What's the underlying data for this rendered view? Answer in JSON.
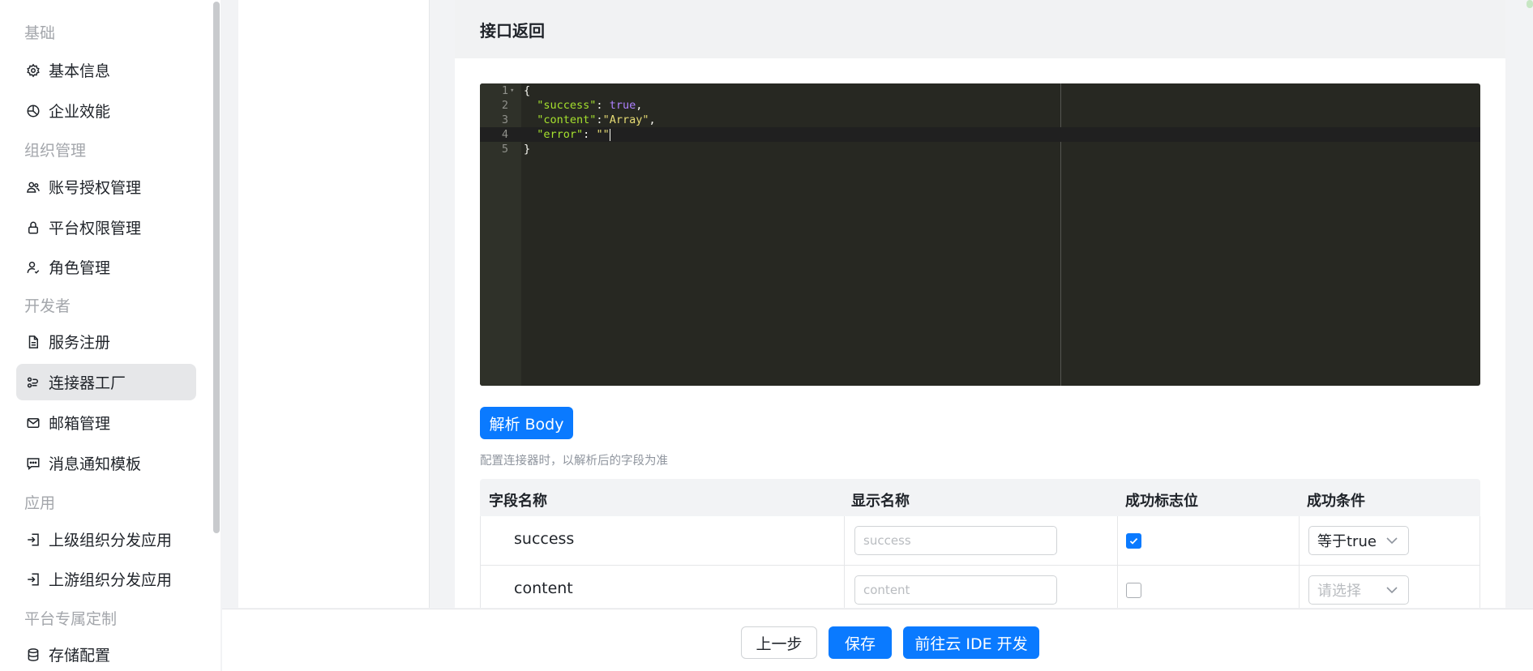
{
  "sidebar": {
    "sections": [
      {
        "label": "基础"
      },
      {
        "label": "组织管理"
      },
      {
        "label": "开发者"
      },
      {
        "label": "应用"
      },
      {
        "label": "平台专属定制"
      }
    ],
    "items": [
      {
        "label": "基本信息",
        "icon": "gear-icon"
      },
      {
        "label": "企业效能",
        "icon": "pie-chart-icon"
      },
      {
        "label": "账号授权管理",
        "icon": "users-icon"
      },
      {
        "label": "平台权限管理",
        "icon": "lock-icon"
      },
      {
        "label": "角色管理",
        "icon": "user-check-icon"
      },
      {
        "label": "服务注册",
        "icon": "document-icon"
      },
      {
        "label": "连接器工厂",
        "icon": "connector-icon",
        "active": true
      },
      {
        "label": "邮箱管理",
        "icon": "mail-icon"
      },
      {
        "label": "消息通知模板",
        "icon": "message-icon"
      },
      {
        "label": "上级组织分发应用",
        "icon": "login-icon"
      },
      {
        "label": "上游组织分发应用",
        "icon": "login-icon"
      },
      {
        "label": "存储配置",
        "icon": "database-icon"
      }
    ]
  },
  "panel": {
    "title": "接口返回"
  },
  "editor": {
    "lines": [
      {
        "num": "1",
        "text": "{"
      },
      {
        "num": "2",
        "key": "\"success\"",
        "sep": ": ",
        "value": "true",
        "end": ","
      },
      {
        "num": "3",
        "key": "\"content\"",
        "sep": ":",
        "value": "\"Array\"",
        "end": ","
      },
      {
        "num": "4",
        "key": "\"error\"",
        "sep": ": ",
        "value": "\"\"",
        "end": ""
      },
      {
        "num": "5",
        "text": "}"
      }
    ]
  },
  "parse_button": "解析 Body",
  "hint": "配置连接器时，以解析后的字段为准",
  "table": {
    "headers": [
      "字段名称",
      "显示名称",
      "成功标志位",
      "成功条件"
    ],
    "rows": [
      {
        "field": "success",
        "display_placeholder": "success",
        "flag": true,
        "condition": "等于true",
        "condition_is_placeholder": false
      },
      {
        "field": "content",
        "display_placeholder": "content",
        "flag": false,
        "condition": "请选择",
        "condition_is_placeholder": true
      }
    ]
  },
  "footer": {
    "prev": "上一步",
    "save": "保存",
    "ide": "前往云 IDE 开发"
  },
  "colors": {
    "primary": "#0a7aff",
    "editor_bg": "#272822",
    "active_item_bg": "#e6e7e9"
  }
}
